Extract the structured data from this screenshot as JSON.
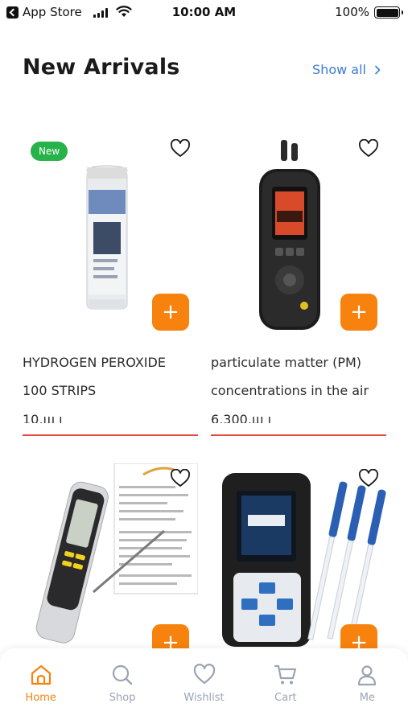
{
  "status_bar": {
    "back_app": "App Store",
    "time": "10:00 AM",
    "battery": "100%"
  },
  "header": {
    "title": "New Arrivals",
    "show_all": "Show all"
  },
  "products": [
    {
      "badge": "New",
      "title_line1": "HYDROGEN PEROXIDE",
      "title_line2": "100 STRIPS",
      "price": "10,ш ı",
      "add_label": "+",
      "favorite": false
    },
    {
      "title_line1": "particulate matter (PM)",
      "title_line2": "concentrations in the air",
      "price": "6,300,ш ı",
      "add_label": "+",
      "favorite": false
    },
    {
      "add_label": "+",
      "favorite": false
    },
    {
      "add_label": "+",
      "favorite": false
    }
  ],
  "nav": {
    "active": "Home",
    "items": [
      {
        "label": "Home",
        "icon": "home-icon"
      },
      {
        "label": "Shop",
        "icon": "search-icon"
      },
      {
        "label": "Wishlist",
        "icon": "heart-icon"
      },
      {
        "label": "Cart",
        "icon": "cart-icon"
      },
      {
        "label": "Me",
        "icon": "user-icon"
      }
    ]
  },
  "colors": {
    "accent": "#f7820d",
    "badge": "#28b34a",
    "link": "#3b7bd4",
    "divider": "#e14b3e",
    "nav_inactive": "#9aa4b2"
  }
}
